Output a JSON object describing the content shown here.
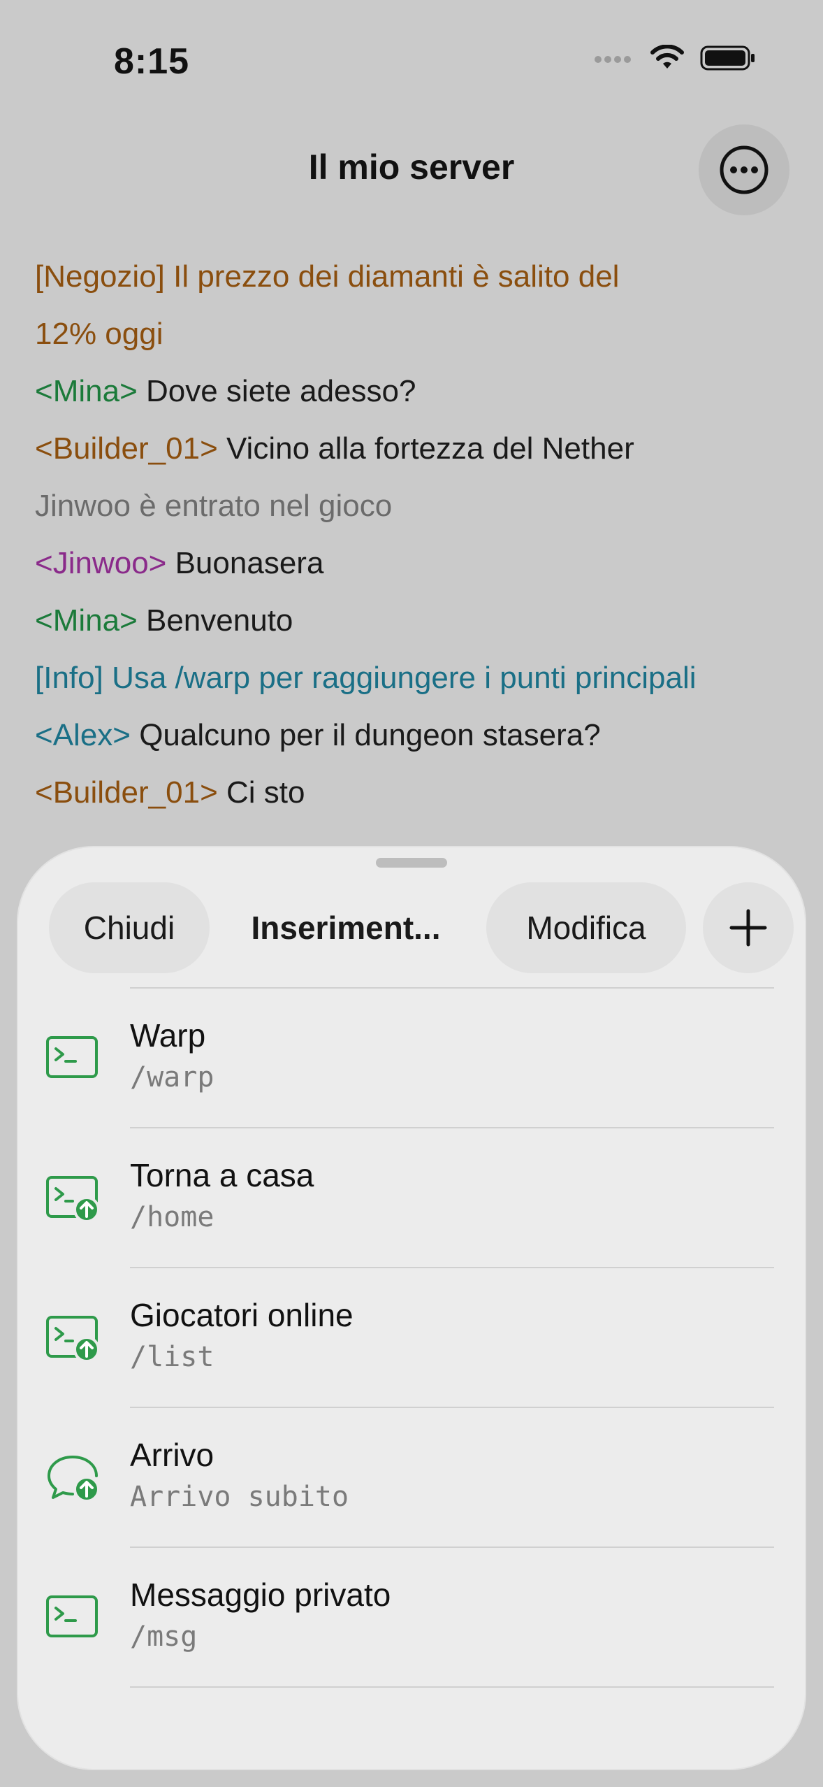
{
  "status": {
    "time": "8:15"
  },
  "nav": {
    "title": "Il mio server"
  },
  "chat": [
    {
      "parts": [
        {
          "text": "[Negozio] Il prezzo dei diamanti è salito del",
          "color": "orange"
        }
      ]
    },
    {
      "parts": [
        {
          "text": "12% oggi",
          "color": "orange"
        }
      ]
    },
    {
      "parts": [
        {
          "text": "<Mina>",
          "color": "green"
        },
        {
          "text": " Dove siete adesso?",
          "color": "default"
        }
      ]
    },
    {
      "parts": [
        {
          "text": "<Builder_01>",
          "color": "orange"
        },
        {
          "text": " Vicino alla fortezza del Nether",
          "color": "default"
        }
      ]
    },
    {
      "parts": [
        {
          "text": "Jinwoo è entrato nel gioco",
          "color": "gray"
        }
      ]
    },
    {
      "parts": [
        {
          "text": "<Jinwoo>",
          "color": "purple"
        },
        {
          "text": " Buonasera",
          "color": "default"
        }
      ]
    },
    {
      "parts": [
        {
          "text": "<Mina>",
          "color": "green"
        },
        {
          "text": " Benvenuto",
          "color": "default"
        }
      ]
    },
    {
      "parts": [
        {
          "text": "[Info] Usa /warp per raggiungere i punti principali",
          "color": "teal"
        }
      ]
    },
    {
      "parts": [
        {
          "text": "<Alex>",
          "color": "teal"
        },
        {
          "text": " Qualcuno per il dungeon stasera?",
          "color": "default"
        }
      ]
    },
    {
      "parts": [
        {
          "text": "<Builder_01>",
          "color": "orange"
        },
        {
          "text": " Ci sto",
          "color": "default"
        }
      ]
    }
  ],
  "sheet": {
    "segments": {
      "close": "Chiudi",
      "insert": "Inseriment...",
      "edit": "Modifica",
      "add": "+"
    },
    "items": [
      {
        "title": "Warp",
        "subtitle": "/warp",
        "icon": "terminal-icon"
      },
      {
        "title": "Torna a casa",
        "subtitle": "/home",
        "icon": "terminal-send-icon"
      },
      {
        "title": "Giocatori online",
        "subtitle": "/list",
        "icon": "terminal-send-icon"
      },
      {
        "title": "Arrivo",
        "subtitle": "Arrivo subito",
        "icon": "chat-send-icon"
      },
      {
        "title": "Messaggio privato",
        "subtitle": "/msg",
        "icon": "terminal-icon"
      }
    ]
  },
  "colors": {
    "accent_green": "#2e9a4a",
    "orange": "#8a4e0e",
    "green": "#1b7a3a",
    "purple": "#8a2a8a",
    "teal": "#1a6f86",
    "gray": "#6b6b6b"
  }
}
